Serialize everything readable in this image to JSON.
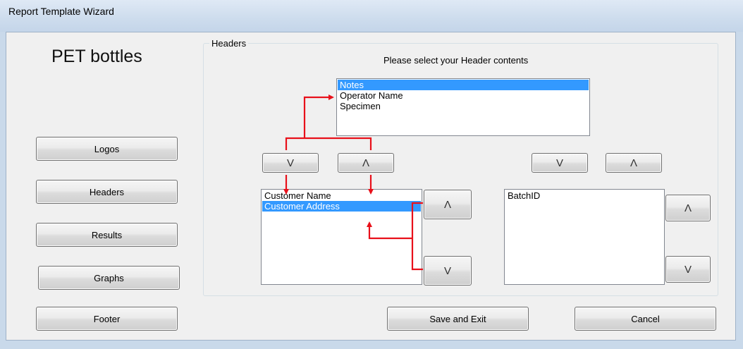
{
  "window": {
    "title": "Report Template Wizard"
  },
  "app_name": "PET bottles",
  "nav": {
    "logos": "Logos",
    "headers": "Headers",
    "results": "Results",
    "graphs": "Graphs",
    "footer": "Footer"
  },
  "group": {
    "label": "Headers",
    "prompt": "Please select your Header contents"
  },
  "arrows": {
    "down": "V",
    "up": "Λ"
  },
  "available_list": {
    "items": [
      "Notes",
      "Operator Name",
      "Specimen"
    ],
    "selected": "Notes"
  },
  "selected_list": {
    "items": [
      "Customer Name",
      "Customer Address"
    ],
    "selected": "Customer Address"
  },
  "right_list": {
    "items": [
      "BatchID"
    ]
  },
  "actions": {
    "save_exit": "Save and Exit",
    "cancel": "Cancel"
  },
  "colors": {
    "selection": "#3399ff",
    "annotation_arrows": "#e8101a"
  }
}
